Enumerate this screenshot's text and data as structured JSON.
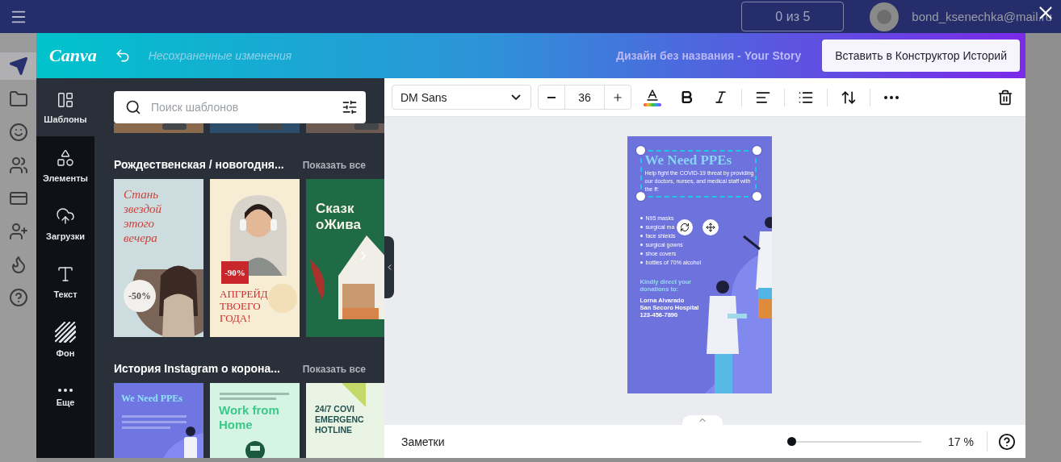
{
  "app": {
    "counter": "0 из 5",
    "user_email": "bond_ksenechka@mail.ru",
    "sidebar": [
      {
        "selected": true
      },
      {
        "selected": false
      },
      {
        "selected": false
      },
      {
        "selected": false
      },
      {
        "selected": false
      },
      {
        "selected": false
      },
      {
        "selected": false
      },
      {
        "selected": false
      }
    ]
  },
  "editor": {
    "logo": "Canva",
    "status": "Несохраненные изменения",
    "design_title": "Дизайн без названия - Your Story",
    "publish_button": "Вставить в Конструктор Историй"
  },
  "rail": [
    {
      "label": "Шаблоны",
      "selected": true
    },
    {
      "label": "Элементы",
      "selected": false
    },
    {
      "label": "Загрузки",
      "selected": false
    },
    {
      "label": "Текст",
      "selected": false
    },
    {
      "label": "Фон",
      "selected": false
    },
    {
      "label": "Еще",
      "selected": false
    }
  ],
  "templates_panel": {
    "search": {
      "placeholder": "Поиск шаблонов"
    },
    "sections": [
      {
        "title": "Рождественская / новогодня...",
        "show_all": "Показать все",
        "templates": [
          {
            "kind": "winter",
            "title_lines": [
              "Стань",
              "звездой",
              "этого",
              "вечера"
            ],
            "badge": "-50%"
          },
          {
            "kind": "headphones",
            "title_lines": [
              "АПГРЕЙД",
              "ТВОЕГО",
              "ГОДА!"
            ],
            "badge": "-90%"
          },
          {
            "kind": "fairy",
            "title_lines": [
              "Сказк",
              "оЖива"
            ]
          }
        ]
      },
      {
        "title": "История Instagram о корона...",
        "show_all": "Показать все",
        "templates": [
          {
            "kind": "ppe",
            "title_lines": [
              "We Need PPEs"
            ]
          },
          {
            "kind": "remote",
            "title_lines": [
              "Work from",
              "Home"
            ]
          },
          {
            "kind": "hotline",
            "title_lines": [
              "24/7 COVI",
              "EMERGENC",
              "HOTLINE"
            ]
          }
        ]
      }
    ]
  },
  "toolbar": {
    "font": "DM Sans",
    "font_size": "36"
  },
  "design": {
    "heading": "We Need PPEs",
    "intro": "Help fight the COVID-19 threat by providing our doctors, nurses, and medical staff with the ff:",
    "items": [
      "N95 masks",
      "surgical ma",
      "face shields",
      "surgical gowns",
      "shoe covers",
      "bottles of 70% alcohol"
    ],
    "cta": "Kindly direct your donations to:",
    "contact": [
      "Lorna Alvarado",
      "San Secoro Hospital",
      "123-456-7890"
    ]
  },
  "footer": {
    "notes": "Заметки",
    "zoom": {
      "level": 0
    },
    "zoom_reading": "17 %"
  }
}
